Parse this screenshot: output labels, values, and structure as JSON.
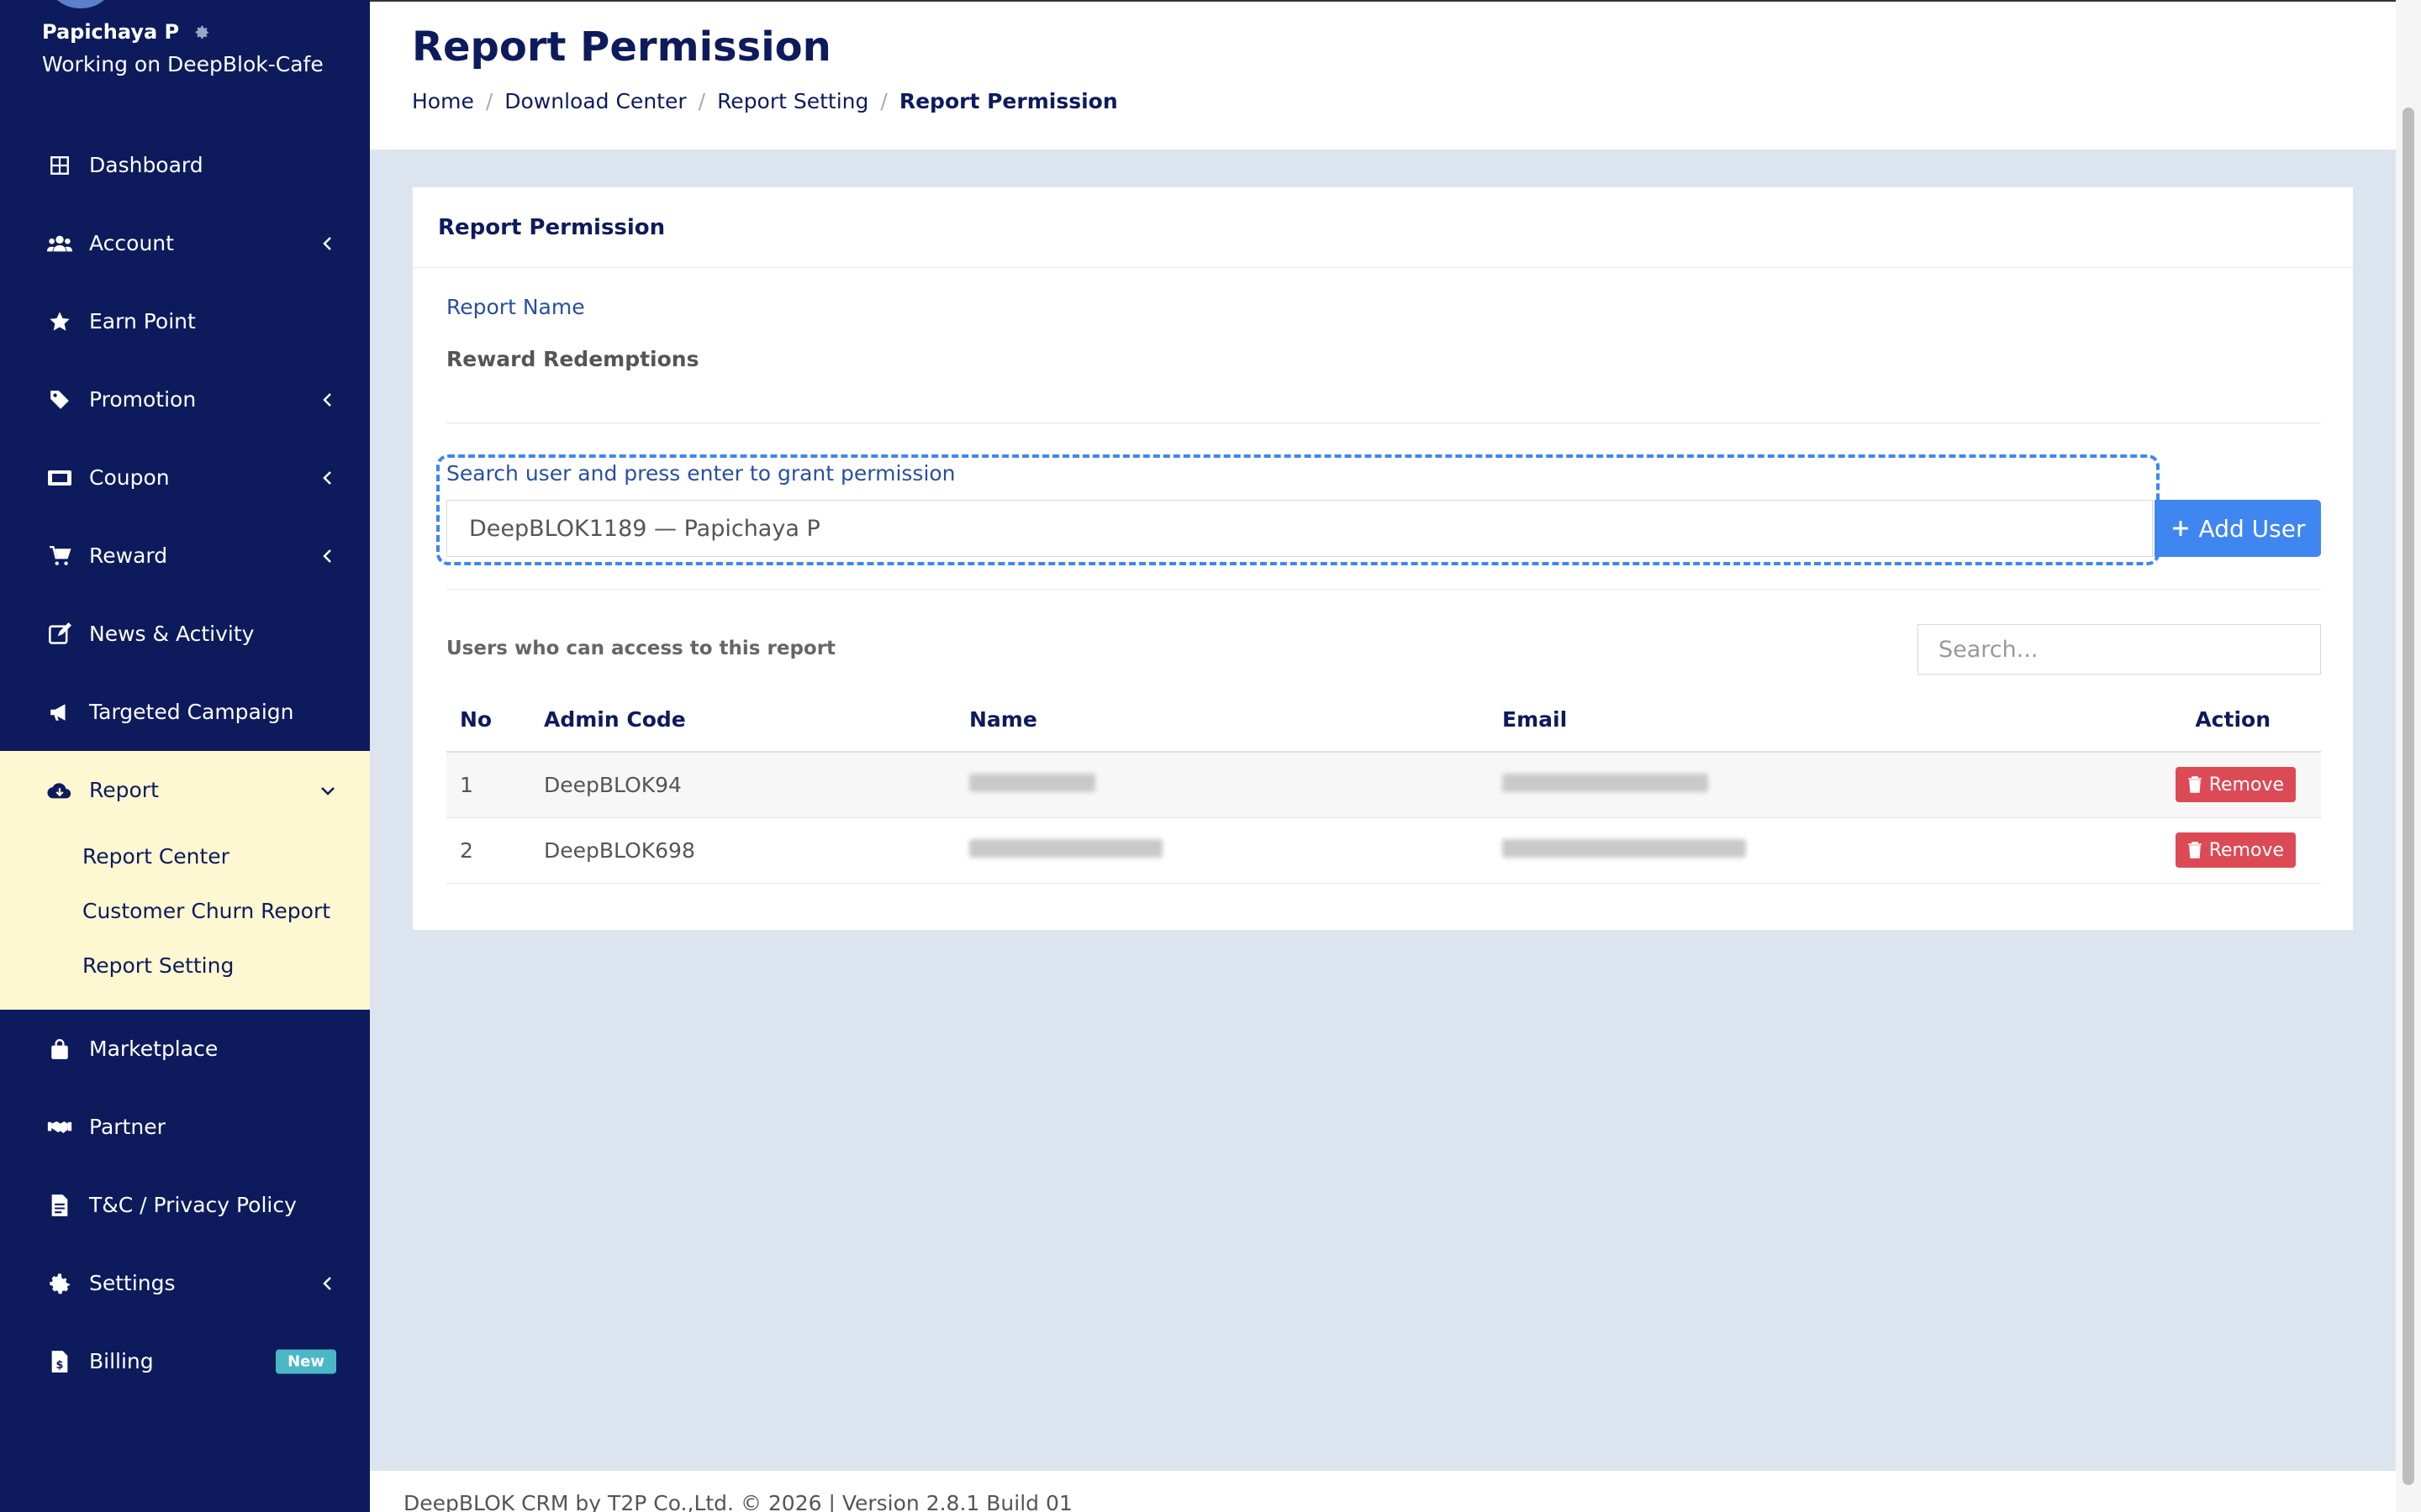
{
  "user": {
    "name": "Papichaya P",
    "working_on": "Working on DeepBlok-Cafe"
  },
  "sidebar": {
    "items": [
      {
        "label": "Dashboard",
        "icon": "dashboard-icon"
      },
      {
        "label": "Account",
        "icon": "users-icon"
      },
      {
        "label": "Earn Point",
        "icon": "star-icon"
      },
      {
        "label": "Promotion",
        "icon": "tag-icon"
      },
      {
        "label": "Coupon",
        "icon": "ticket-icon"
      },
      {
        "label": "Reward",
        "icon": "cart-icon"
      },
      {
        "label": "News & Activity",
        "icon": "edit-icon"
      },
      {
        "label": "Targeted Campaign",
        "icon": "megaphone-icon"
      },
      {
        "label": "Report",
        "icon": "cloud-download-icon"
      },
      {
        "label": "Marketplace",
        "icon": "bag-icon"
      },
      {
        "label": "Partner",
        "icon": "handshake-icon"
      },
      {
        "label": "T&C / Privacy Policy",
        "icon": "file-icon"
      },
      {
        "label": "Settings",
        "icon": "gear-icon"
      },
      {
        "label": "Billing",
        "icon": "invoice-icon",
        "badge": "New"
      }
    ],
    "report_sub": [
      "Report Center",
      "Customer Churn Report",
      "Report Setting"
    ]
  },
  "header": {
    "title": "Report Permission",
    "breadcrumb": [
      "Home",
      "Download Center",
      "Report Setting",
      "Report Permission"
    ]
  },
  "card": {
    "title": "Report Permission",
    "report_name_label": "Report Name",
    "report_name_value": "Reward Redemptions",
    "search_label": "Search user and press enter to grant permission",
    "search_value": "DeepBLOK1189 — Papichaya P",
    "add_user_label": "Add User",
    "users_label": "Users who can access to this report",
    "table_search_placeholder": "Search...",
    "columns": [
      "No",
      "Admin Code",
      "Name",
      "Email",
      "Action"
    ],
    "rows": [
      {
        "no": "1",
        "admin_code": "DeepBLOK94",
        "action": "Remove"
      },
      {
        "no": "2",
        "admin_code": "DeepBLOK698",
        "action": "Remove"
      }
    ]
  },
  "footer": {
    "text": "DeepBLOK CRM by T2P Co.,Ltd. © 2026 | Version 2.8.1 Build 01"
  },
  "colors": {
    "sidebar_bg": "#0d1b5c",
    "accent": "#3f86f0",
    "danger": "#dc4a55",
    "badge": "#4ab7c6",
    "active_group_bg": "#fdf7d2"
  }
}
